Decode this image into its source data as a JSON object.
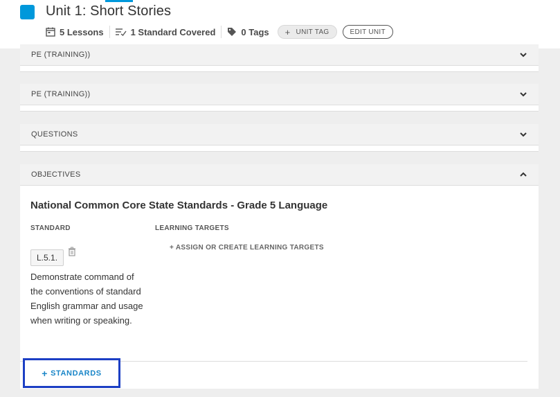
{
  "header": {
    "unit_title": "Unit 1: Short Stories",
    "lessons": "5 Lessons",
    "standards_covered": "1 Standard Covered",
    "tags": "0 Tags",
    "unit_tag_button": "UNIT TAG",
    "edit_unit_button": "EDIT UNIT",
    "accent_color": "#0098db"
  },
  "panels": [
    {
      "label": "PE (TRAINING))"
    },
    {
      "label": "PE (TRAINING))"
    },
    {
      "label": "QUESTIONS"
    },
    {
      "label": "OBJECTIVES"
    }
  ],
  "objectives": {
    "title": "National Common Core State Standards - Grade 5 Language",
    "col_standard": "STANDARD",
    "col_targets": "LEARNING TARGETS",
    "standard_code": "L.5.1.",
    "standard_desc": "Demonstrate command of the conventions of standard English grammar and usage when writing or speaking.",
    "assign_targets": "ASSIGN OR CREATE LEARNING TARGETS",
    "add_standards": "STANDARDS"
  }
}
